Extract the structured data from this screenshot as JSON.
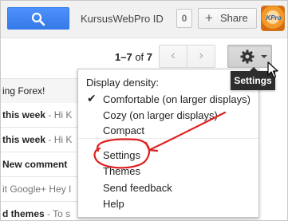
{
  "topbar": {
    "search_icon": "search-icon",
    "account_name": "KursusWebPro ID",
    "notification_count": "0",
    "share_label": "Share",
    "share_icon": "plus-icon",
    "avatar_text": "KPro"
  },
  "toolbar": {
    "pager_range": "1–7",
    "pager_of": "of",
    "pager_total": "7",
    "prev_icon": "chevron-left-icon",
    "next_icon": "chevron-right-icon",
    "settings_icon": "gear-icon",
    "settings_tooltip": "Settings"
  },
  "email_list": {
    "header": "ing Forex!",
    "rows": [
      {
        "bold": "this week",
        "snippet": " - Hi K"
      },
      {
        "bold": "this week",
        "snippet": " - Hi K"
      },
      {
        "bold": "New comment",
        "snippet": ""
      },
      {
        "bold": "",
        "snippet": "it Google+ Hey I"
      },
      {
        "bold": "d themes",
        "snippet": " - To s"
      }
    ]
  },
  "settings_menu": {
    "heading": "Display density:",
    "items": [
      {
        "label": "Comfortable (on larger displays)",
        "checked": true
      },
      {
        "label": "Cozy (on larger displays)",
        "checked": false
      },
      {
        "label": "Compact",
        "checked": false
      },
      {
        "label": "Settings",
        "checked": false
      },
      {
        "label": "Themes",
        "checked": false
      },
      {
        "label": "Send feedback",
        "checked": false
      },
      {
        "label": "Help",
        "checked": false
      }
    ]
  },
  "colors": {
    "search_blue": "#4d90fe",
    "annotation_red": "#e02020",
    "tooltip_bg": "#2d2d2d"
  }
}
